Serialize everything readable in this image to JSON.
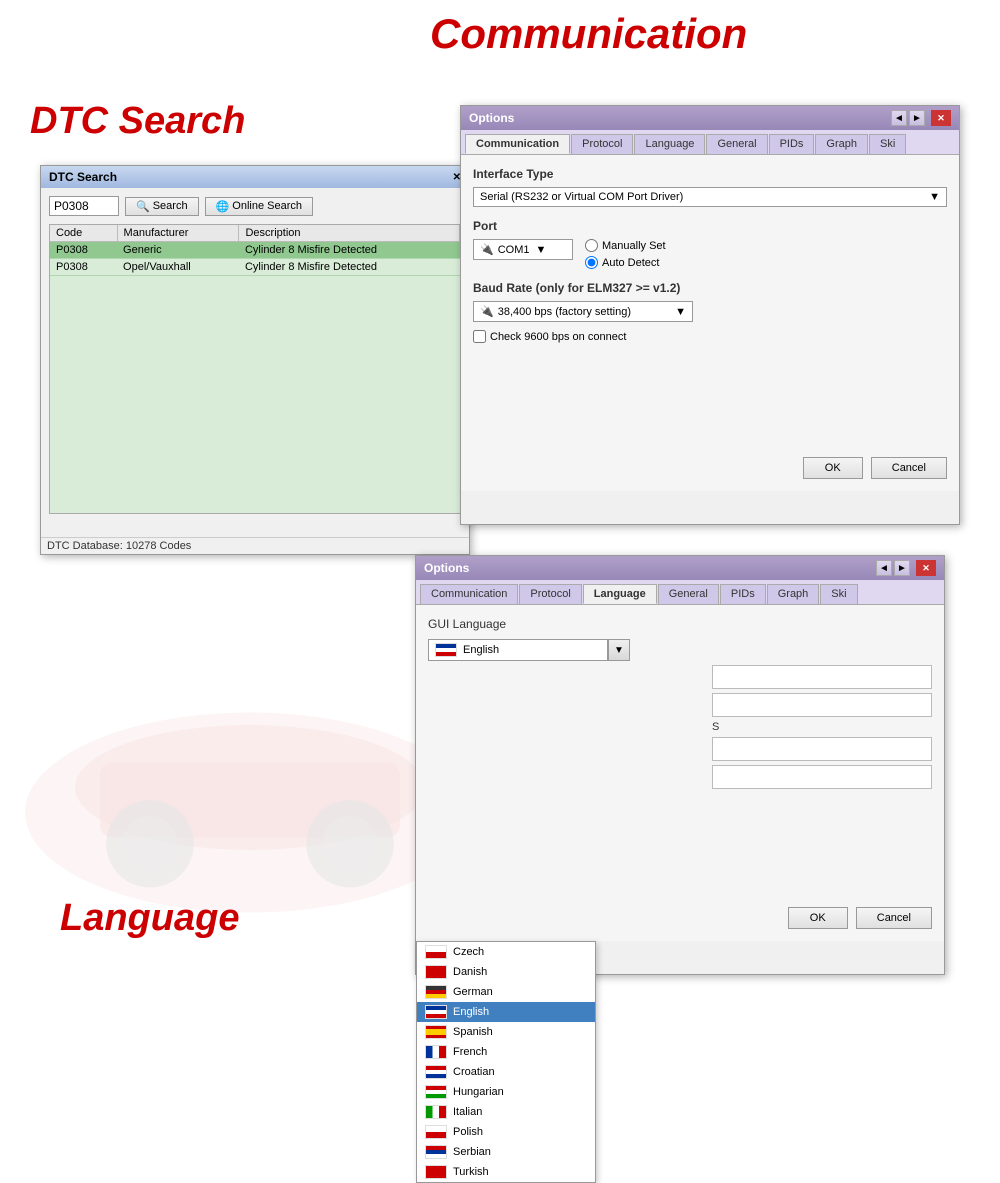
{
  "page": {
    "background_color": "#ffffff"
  },
  "titles": {
    "communication": "Communication",
    "dtc_search": "DTC Search",
    "language": "Language"
  },
  "dtc_window": {
    "title": "DTC Search",
    "search_value": "P0308",
    "search_btn": "Search",
    "online_search_btn": "Online Search",
    "columns": [
      "Code",
      "Manufacturer",
      "Description"
    ],
    "rows": [
      {
        "code": "P0308",
        "manufacturer": "Generic",
        "description": "Cylinder 8 Misfire Detected",
        "selected": true
      },
      {
        "code": "P0308",
        "manufacturer": "Opel/Vauxhall",
        "description": "Cylinder 8 Misfire Detected",
        "selected": false
      }
    ],
    "status": "DTC Database: 10278 Codes",
    "close_btn": "Close"
  },
  "options_comm": {
    "title": "Options",
    "tabs": [
      "Communication",
      "Protocol",
      "Language",
      "General",
      "PIDs",
      "Graph",
      "Ski"
    ],
    "active_tab": "Communication",
    "interface_type_label": "Interface Type",
    "interface_type_value": "Serial (RS232 or Virtual COM Port Driver)",
    "port_label": "Port",
    "port_value": "COM1",
    "radio_manually": "Manually Set",
    "radio_auto": "Auto Detect",
    "baud_label": "Baud Rate (only for ELM327 >= v1.2)",
    "baud_value": "38,400 bps (factory setting)",
    "checkbox_label": "Check 9600 bps on connect",
    "ok_btn": "OK",
    "cancel_btn": "Cancel"
  },
  "options_lang": {
    "title": "Options",
    "tabs": [
      "Communication",
      "Protocol",
      "Language",
      "General",
      "PIDs",
      "Graph",
      "Ski"
    ],
    "active_tab": "Language",
    "gui_lang_label": "GUI Language",
    "selected_lang": "English",
    "s_label": "S",
    "ok_btn": "OK",
    "cancel_btn": "Cancel",
    "languages": [
      {
        "name": "English",
        "flag": "uk"
      },
      {
        "name": "Czech",
        "flag": "cz"
      },
      {
        "name": "Danish",
        "flag": "dk"
      },
      {
        "name": "German",
        "flag": "de"
      },
      {
        "name": "English",
        "flag": "uk",
        "selected": true
      },
      {
        "name": "Spanish",
        "flag": "es"
      },
      {
        "name": "French",
        "flag": "fr"
      },
      {
        "name": "Croatian",
        "flag": "hr"
      },
      {
        "name": "Hungarian",
        "flag": "hu"
      },
      {
        "name": "Italian",
        "flag": "it"
      },
      {
        "name": "Polish",
        "flag": "pl"
      },
      {
        "name": "Serbian",
        "flag": "rs"
      },
      {
        "name": "Turkish",
        "flag": "tr"
      }
    ]
  },
  "icons": {
    "close": "✕",
    "arrow_down": "▼",
    "arrow_left": "◄",
    "arrow_right": "►",
    "search": "🔍",
    "online": "🌐"
  }
}
